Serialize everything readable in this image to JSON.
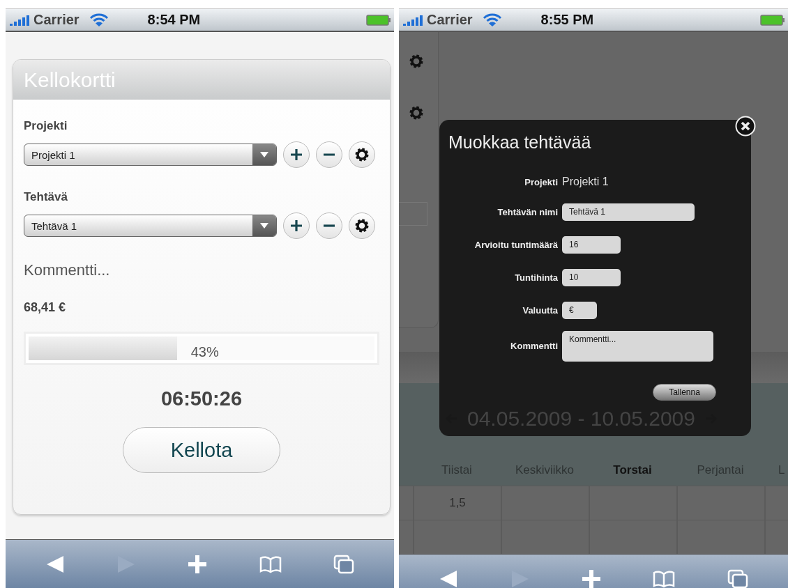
{
  "left_screen": {
    "status_bar": {
      "carrier": "Carrier",
      "time": "8:54 PM"
    },
    "card": {
      "title": "Kellokortti",
      "selects": [
        {
          "label": "Projekti",
          "value": "Projekti 1"
        },
        {
          "label": "Tehtävä",
          "value": "Tehtävä 1"
        }
      ],
      "comment": "Kommentti...",
      "amount": "68,41 €",
      "progress": {
        "level": 0.43,
        "reading": "43%"
      },
      "timer": "06:50:26",
      "button": "Kellota"
    },
    "toolbar": {
      "forward_disabled": true
    }
  },
  "right_screen": {
    "status_bar": {
      "carrier": "Carrier",
      "time": "8:55 PM"
    },
    "background": {
      "date_range": "04.05.2009 - 10.05.2009",
      "columns": [
        {
          "label": "Tiistai",
          "today": false
        },
        {
          "label": "Keskiviikko",
          "today": false
        },
        {
          "label": "Torstai",
          "today": true
        },
        {
          "label": "Perjantai",
          "today": false
        },
        {
          "label": "L",
          "today": false
        }
      ],
      "rows": [
        [
          "1,5",
          "",
          "",
          "",
          ""
        ]
      ]
    },
    "dialog": {
      "title": "Muokkaa tehtävää",
      "fields": [
        {
          "label": "Projekti",
          "kind": "text",
          "value": "Projekti 1"
        },
        {
          "label": "Tehtävän nimi",
          "kind": "wide",
          "value": "Tehtävä 1"
        },
        {
          "label": "Arvioitu tuntimäärä",
          "kind": "medium",
          "value": "16"
        },
        {
          "label": "Tuntihinta",
          "kind": "medium",
          "value": "10"
        },
        {
          "label": "Valuutta",
          "kind": "small",
          "value": "€"
        },
        {
          "label": "Kommentti",
          "kind": "textarea",
          "value": "Kommentti..."
        }
      ],
      "button": "Tallenna"
    },
    "toolbar": {
      "forward_disabled": true
    }
  }
}
